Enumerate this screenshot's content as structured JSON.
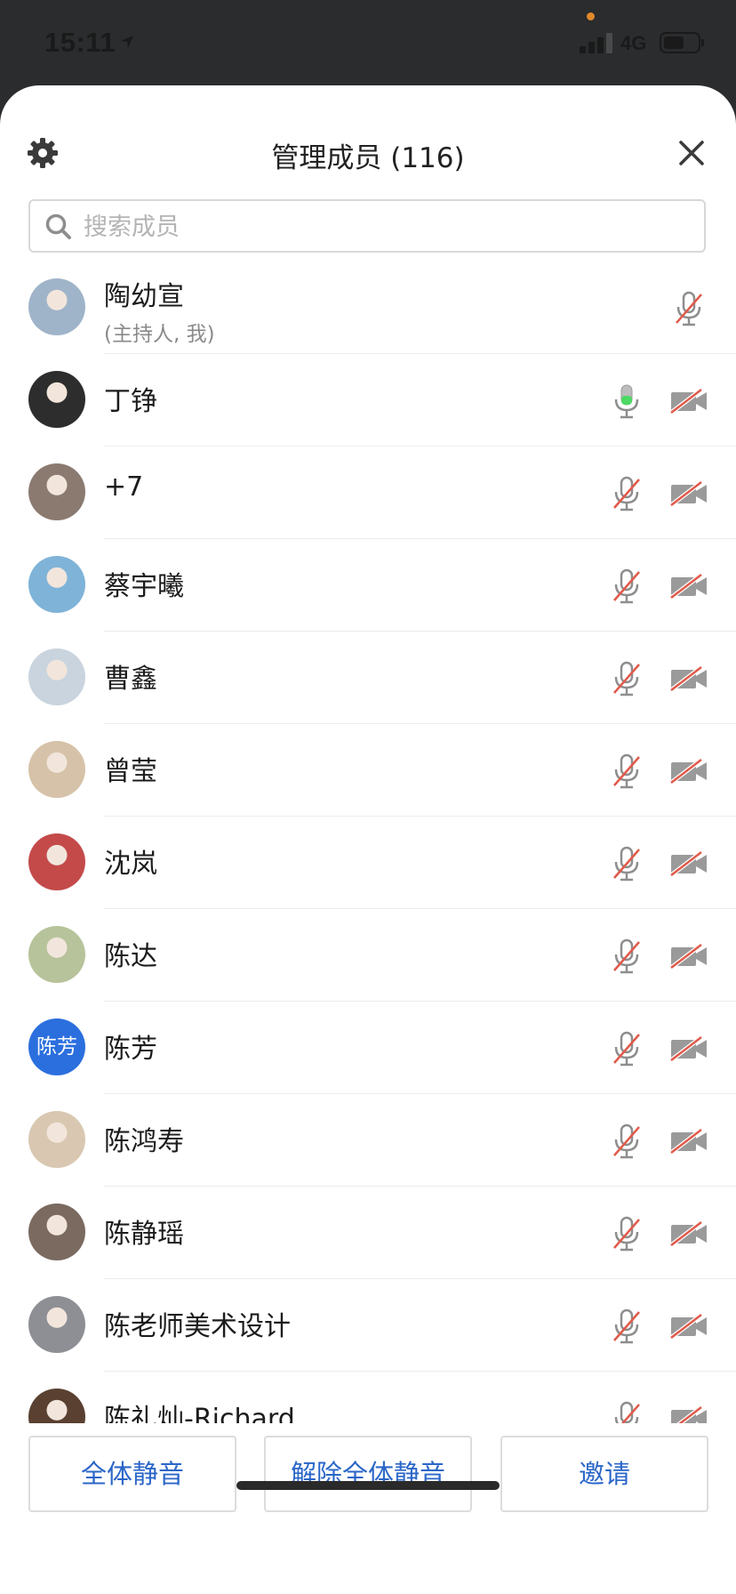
{
  "status_bar": {
    "time": "15:11",
    "network": "4G"
  },
  "dialog": {
    "title": "管理成员 (116)",
    "search_placeholder": "搜索成员"
  },
  "members": [
    {
      "name": "陶幼宣",
      "subtitle": "(主持人, 我)",
      "avatar": "photo",
      "mic": "muted",
      "camera": "none"
    },
    {
      "name": "丁铮",
      "avatar": "photo",
      "mic": "active",
      "camera": "off"
    },
    {
      "name": "+7",
      "avatar": "photo",
      "mic": "muted",
      "camera": "off"
    },
    {
      "name": "蔡宇曦",
      "avatar": "photo",
      "mic": "muted",
      "camera": "off"
    },
    {
      "name": "曹鑫",
      "avatar": "photo",
      "mic": "muted",
      "camera": "off"
    },
    {
      "name": "曾莹",
      "avatar": "photo",
      "mic": "muted",
      "camera": "off"
    },
    {
      "name": "沈岚",
      "avatar": "photo",
      "mic": "muted",
      "camera": "off"
    },
    {
      "name": "陈达",
      "avatar": "photo",
      "mic": "muted",
      "camera": "off"
    },
    {
      "name": "陈芳",
      "avatar": "text",
      "avatar_text": "陈芳",
      "mic": "muted",
      "camera": "off"
    },
    {
      "name": "陈鸿寿",
      "avatar": "photo",
      "mic": "muted",
      "camera": "off"
    },
    {
      "name": "陈静瑶",
      "avatar": "photo",
      "mic": "muted",
      "camera": "off"
    },
    {
      "name": "陈老师美术设计",
      "avatar": "photo",
      "mic": "muted",
      "camera": "off"
    },
    {
      "name": "陈礼灿-Richard",
      "avatar": "photo",
      "mic": "muted",
      "camera": "off"
    }
  ],
  "footer": {
    "mute_all": "全体静音",
    "unmute_all": "解除全体静音",
    "invite": "邀请"
  },
  "colors": {
    "accent": "#2a66c8",
    "mute_slash": "#e05a4a",
    "mic_active": "#4cd964",
    "avatar_text_bg": "#2b6fde"
  }
}
